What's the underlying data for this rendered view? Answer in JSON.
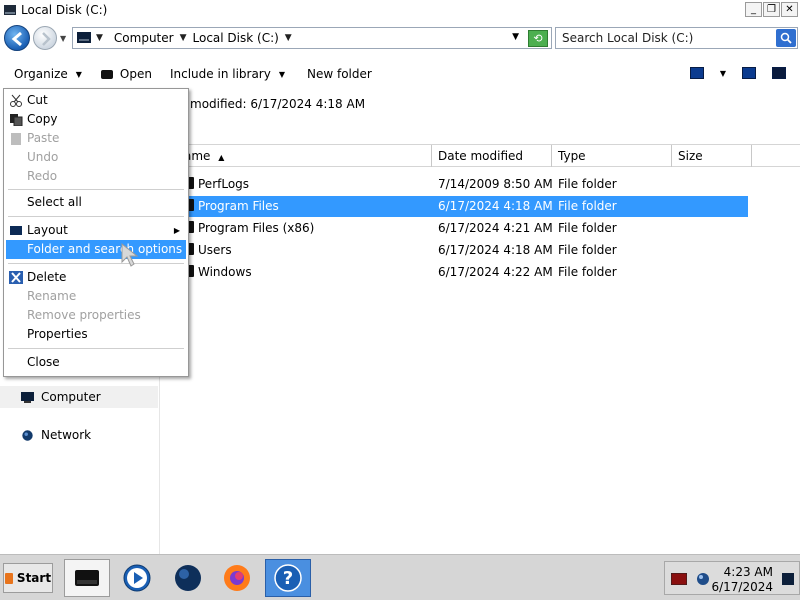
{
  "window": {
    "title": "Local Disk (C:)"
  },
  "title_controls": {
    "minimize": "_",
    "maximize": "❐",
    "close": "✕"
  },
  "address": {
    "breadcrumbs": [
      {
        "label": "Computer"
      },
      {
        "label": "Local Disk (C:)"
      }
    ]
  },
  "search": {
    "placeholder": "Search Local Disk (C:)"
  },
  "toolbar": {
    "organize": "Organize",
    "open": "Open",
    "include_in_library": "Include in library",
    "new_folder": "New folder"
  },
  "details": {
    "modified_text": "modified: 6/17/2024 4:18 AM"
  },
  "columns": {
    "name": "ame",
    "date_modified": "Date modified",
    "type": "Type",
    "size": "Size"
  },
  "files": [
    {
      "name": "PerfLogs",
      "date": "7/14/2009 8:50 AM",
      "type": "File folder"
    },
    {
      "name": "Program Files",
      "date": "6/17/2024 4:18 AM",
      "type": "File folder",
      "selected": true
    },
    {
      "name": "Program Files (x86)",
      "date": "6/17/2024 4:21 AM",
      "type": "File folder"
    },
    {
      "name": "Users",
      "date": "6/17/2024 4:18 AM",
      "type": "File folder"
    },
    {
      "name": "Windows",
      "date": "6/17/2024 4:22 AM",
      "type": "File folder"
    }
  ],
  "nav_pane": {
    "computer": "Computer",
    "network": "Network"
  },
  "context_menu": {
    "cut": "Cut",
    "copy": "Copy",
    "paste": "Paste",
    "undo": "Undo",
    "redo": "Redo",
    "select_all": "Select all",
    "layout": "Layout",
    "folder_options": "Folder and search options",
    "delete": "Delete",
    "rename": "Rename",
    "remove_properties": "Remove properties",
    "properties": "Properties",
    "close": "Close"
  },
  "taskbar": {
    "start": "Start",
    "clock_time": "4:23 AM",
    "clock_date": "6/17/2024"
  },
  "colors": {
    "selection": "#3399ff",
    "taskbar": "#d6d6d6"
  }
}
